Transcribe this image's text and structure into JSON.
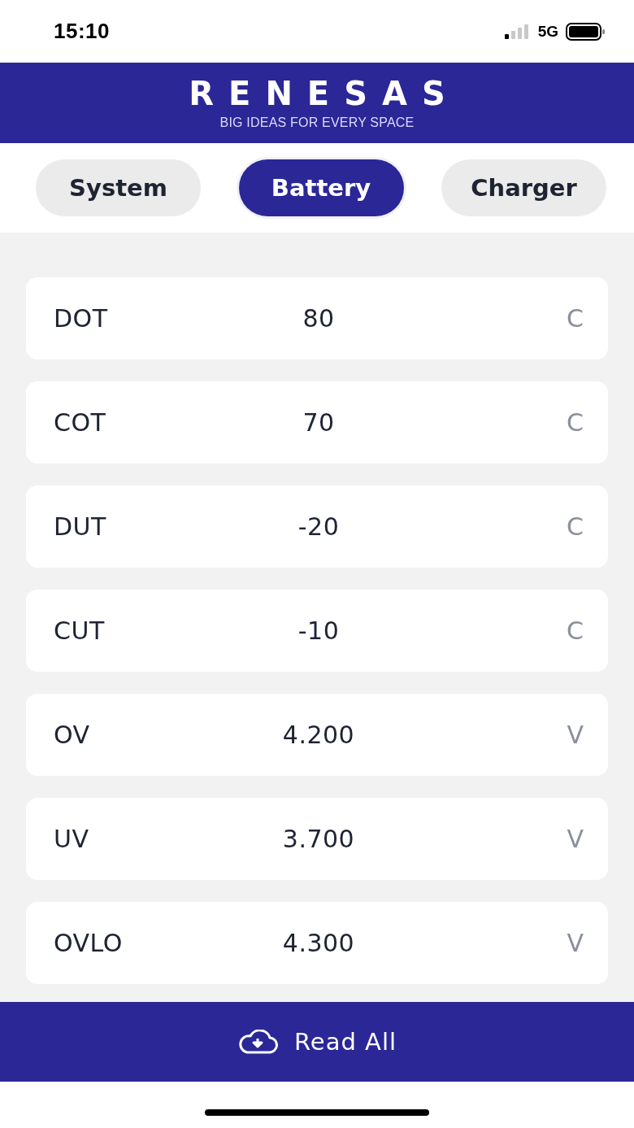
{
  "status_bar": {
    "time": "15:10",
    "network": "5G"
  },
  "header": {
    "logo": "RENESAS",
    "tagline": "BIG IDEAS FOR EVERY SPACE"
  },
  "tabs": [
    {
      "label": "System",
      "selected": false
    },
    {
      "label": "Battery",
      "selected": true
    },
    {
      "label": "Charger",
      "selected": false
    }
  ],
  "parameters": [
    {
      "name": "DOT",
      "value": "80",
      "unit": "C"
    },
    {
      "name": "COT",
      "value": "70",
      "unit": "C"
    },
    {
      "name": "DUT",
      "value": "-20",
      "unit": "C"
    },
    {
      "name": "CUT",
      "value": "-10",
      "unit": "C"
    },
    {
      "name": "OV",
      "value": "4.200",
      "unit": "V"
    },
    {
      "name": "UV",
      "value": "3.700",
      "unit": "V"
    },
    {
      "name": "OVLO",
      "value": "4.300",
      "unit": "V"
    }
  ],
  "read_button": {
    "label": "Read All"
  }
}
